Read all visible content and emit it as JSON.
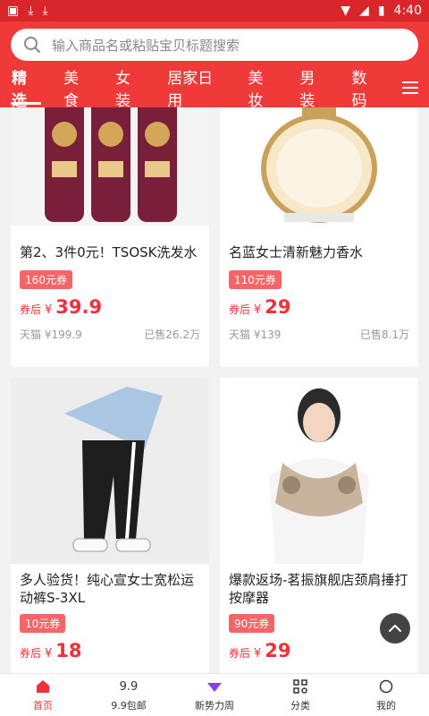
{
  "status": {
    "time": "4:40"
  },
  "search": {
    "placeholder": "输入商品名或粘贴宝贝标题搜索"
  },
  "tabs": [
    {
      "label": "精选",
      "active": true
    },
    {
      "label": "美食"
    },
    {
      "label": "女装"
    },
    {
      "label": "居家日用"
    },
    {
      "label": "美妆"
    },
    {
      "label": "男装"
    },
    {
      "label": "数码"
    }
  ],
  "products": [
    {
      "title": "第2、3件0元！TSOSK洗发水",
      "coupon": "160元券",
      "price_prefix": "券后",
      "currency": "¥",
      "price": "39.9",
      "shop": "天猫 ¥199.9",
      "sold": "已售26.2万"
    },
    {
      "title": "名蓝女士清新魅力香水",
      "coupon": "110元券",
      "price_prefix": "券后",
      "currency": "¥",
      "price": "29",
      "shop": "天猫 ¥139",
      "sold": "已售8.1万"
    },
    {
      "title": "多人验货！纯心宣女士宽松运动裤S-3XL",
      "coupon": "10元券",
      "price_prefix": "券后",
      "currency": "¥",
      "price": "18"
    },
    {
      "title": "爆款返场-茗振旗舰店颈肩捶打按摩器",
      "coupon": "90元券",
      "price_prefix": "券后",
      "currency": "¥",
      "price": "29"
    }
  ],
  "bottom_nav": [
    {
      "label": "首页",
      "active": true,
      "icon": "home-icon"
    },
    {
      "label": "9.9包邮",
      "icon": "nine-nine-icon"
    },
    {
      "label": "新势力周",
      "icon": "new-power-icon"
    },
    {
      "label": "分类",
      "icon": "category-grid-icon"
    },
    {
      "label": "我的",
      "icon": "profile-icon"
    }
  ],
  "colors": {
    "brand_red": "#f03a3a",
    "price_red": "#f0303a",
    "coupon_bg": "#f56565"
  }
}
